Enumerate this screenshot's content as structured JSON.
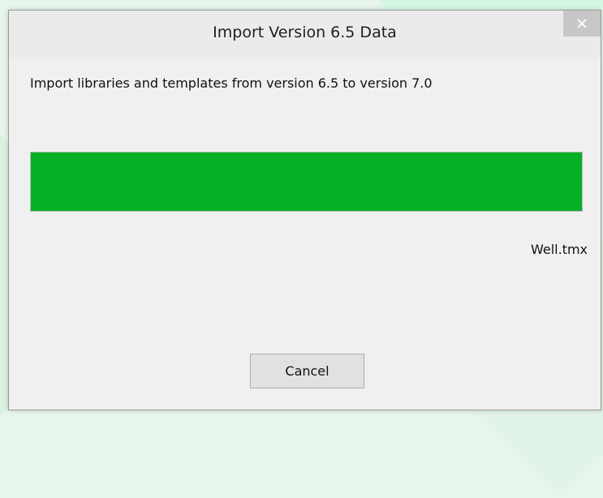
{
  "dialog": {
    "title": "Import Version 6.5 Data",
    "close_icon": "close-icon",
    "message": "Import libraries and templates from version 6.5 to version 7.0",
    "progress_percent": 100,
    "progress_color": "#06b025",
    "current_file": "Well.tmx",
    "cancel_label": "Cancel"
  }
}
